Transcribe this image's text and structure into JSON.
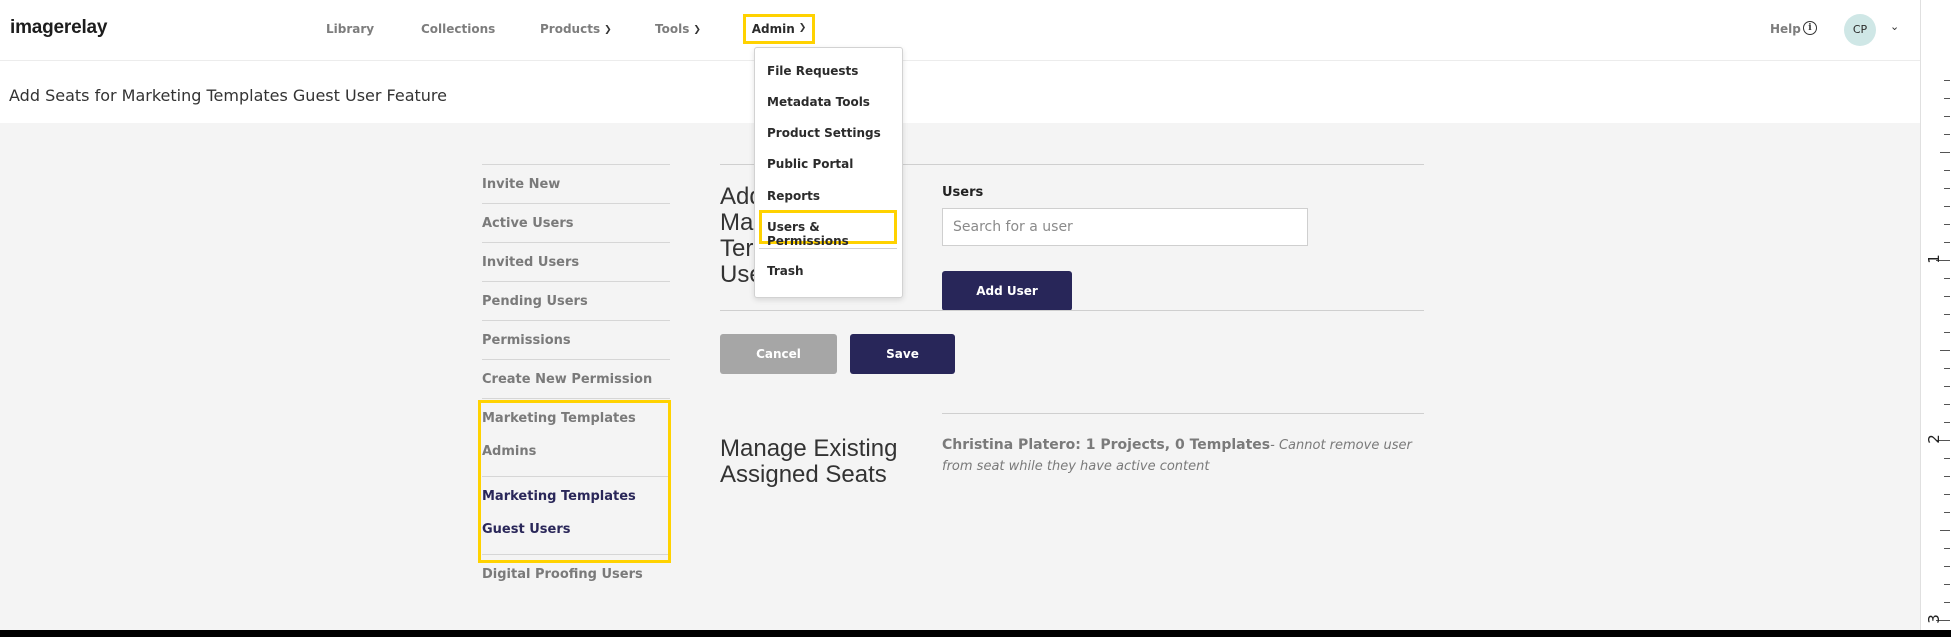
{
  "app": {
    "logo_text": "imagerelay"
  },
  "nav": {
    "library": "Library",
    "collections": "Collections",
    "products": "Products",
    "tools": "Tools",
    "admin": "Admin",
    "help": "Help",
    "info_glyph": "i",
    "user_initials": "CP"
  },
  "admin_menu": {
    "items": [
      "File Requests",
      "Metadata Tools",
      "Product Settings",
      "Public Portal",
      "Reports",
      "Users & Permissions",
      "Trash"
    ],
    "highlighted": "Users & Permissions"
  },
  "page": {
    "title": "Add Seats for Marketing Templates Guest User Feature"
  },
  "sidebar": {
    "items": [
      "Invite New",
      "Active Users",
      "Invited Users",
      "Pending Users",
      "Permissions",
      "Create New Permission",
      "Marketing Templates",
      "Admins",
      "Marketing Templates",
      "Guest Users",
      "Digital Proofing Users"
    ]
  },
  "add_section": {
    "title_lines": [
      "Add",
      "Ma",
      "Ter",
      "Use"
    ],
    "users_label": "Users",
    "search_placeholder": "Search for a user",
    "add_user_button": "Add User",
    "cancel_button": "Cancel",
    "save_button": "Save"
  },
  "manage_section": {
    "title_line1": "Manage Existing",
    "title_line2": "Assigned Seats",
    "seat_owner": "Christina Platero: 1 Projects, 0 Templates",
    "seat_note": "- Cannot remove user from seat while they have active content"
  },
  "ruler": {
    "labels": [
      "1",
      "2",
      "3"
    ]
  },
  "colors": {
    "accent": "#282659",
    "highlight": "#ffd200",
    "background": "#f4f4f4"
  }
}
